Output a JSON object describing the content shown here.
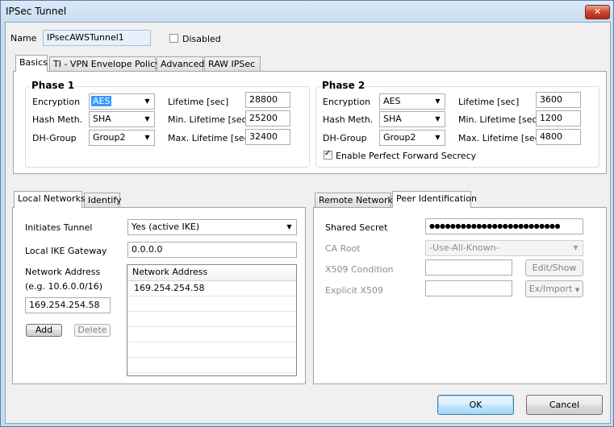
{
  "window": {
    "title": "IPSec Tunnel",
    "close_label": "✕"
  },
  "name_field": {
    "label": "Name",
    "value": "IPsecAWSTunnel1"
  },
  "disabled_checkbox": {
    "label": "Disabled",
    "checked": false
  },
  "top_tabs": [
    "Basics",
    "TI - VPN Envelope Policy",
    "Advanced",
    "RAW IPSec"
  ],
  "phase1": {
    "title": "Phase 1",
    "encryption": {
      "label": "Encryption",
      "value": "AES"
    },
    "hash": {
      "label": "Hash Meth.",
      "value": "SHA"
    },
    "dh": {
      "label": "DH-Group",
      "value": "Group2"
    },
    "lifetime": {
      "label": "Lifetime [sec]",
      "value": "28800"
    },
    "min_lifetime": {
      "label": "Min. Lifetime [sec]",
      "value": "25200"
    },
    "max_lifetime": {
      "label": "Max. Lifetime [sec]",
      "value": "32400"
    }
  },
  "phase2": {
    "title": "Phase 2",
    "encryption": {
      "label": "Encryption",
      "value": "AES"
    },
    "hash": {
      "label": "Hash Meth.",
      "value": "SHA"
    },
    "dh": {
      "label": "DH-Group",
      "value": "Group2"
    },
    "lifetime": {
      "label": "Lifetime [sec]",
      "value": "3600"
    },
    "min_lifetime": {
      "label": "Min. Lifetime [sec]",
      "value": "1200"
    },
    "max_lifetime": {
      "label": "Max. Lifetime [sec]",
      "value": "4800"
    },
    "pfs": {
      "label": "Enable Perfect Forward Secrecy",
      "checked": true,
      "mark": "✓"
    }
  },
  "local_tabs": [
    "Local Networks",
    "Identify"
  ],
  "local": {
    "initiates_label": "Initiates Tunnel",
    "initiates_value": "Yes (active IKE)",
    "gateway_label": "Local IKE Gateway",
    "gateway_value": "0.0.0.0",
    "network_label": "Network Address",
    "network_hint": "(e.g. 10.6.0.0/16)",
    "network_value": "169.254.254.58",
    "add_label": "Add",
    "delete_label": "Delete",
    "list_header": "Network Address",
    "list_rows": [
      "169.254.254.58"
    ]
  },
  "remote_tabs": [
    "Remote Networks",
    "Peer Identification"
  ],
  "peer": {
    "secret_label": "Shared Secret",
    "secret_value": "●●●●●●●●●●●●●●●●●●●●●●●●●",
    "ca_label": "CA Root",
    "ca_value": "-Use-All-Known-",
    "x509_label": "X509 Condition",
    "edit_label": "Edit/Show",
    "explicit_label": "Explicit X509",
    "import_label": "Ex/Import"
  },
  "dialog": {
    "ok_label": "OK",
    "cancel_label": "Cancel"
  },
  "icons": {
    "dropdown": "▼"
  }
}
